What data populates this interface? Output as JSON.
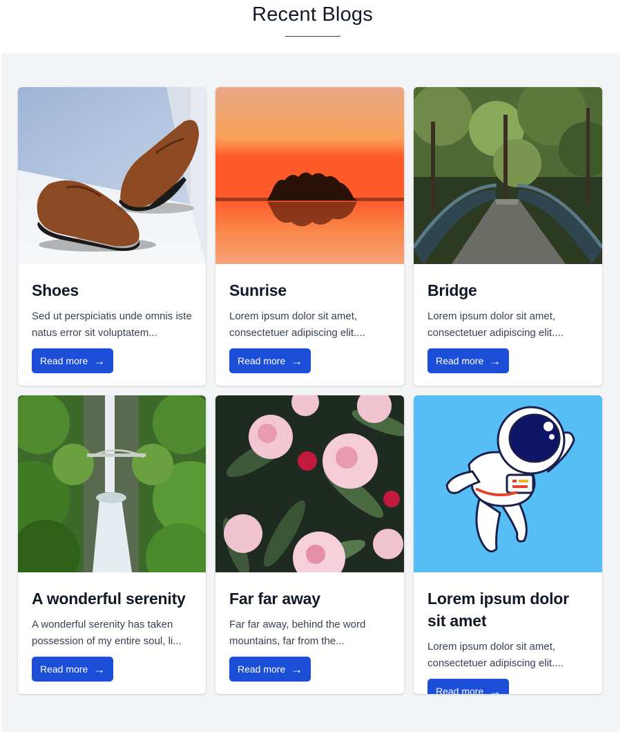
{
  "header": {
    "title": "Recent Blogs"
  },
  "colors": {
    "background": "#f3f4f6",
    "button": "#1d4ed8",
    "card": "#ffffff"
  },
  "posts": [
    {
      "title": "Shoes",
      "excerpt": "Sed ut perspiciatis unde omnis iste natus error sit voluptatem...",
      "button": "Read more",
      "image_icon": "shoes-image"
    },
    {
      "title": "Sunrise",
      "excerpt": "Lorem ipsum dolor sit amet, consectetuer adipiscing elit....",
      "button": "Read more",
      "image_icon": "sunrise-image"
    },
    {
      "title": "Bridge",
      "excerpt": "Lorem ipsum dolor sit amet, consectetuer adipiscing elit....",
      "button": "Read more",
      "image_icon": "bridge-image"
    },
    {
      "title": "A wonderful serenity",
      "excerpt": "A wonderful serenity has taken possession of my entire soul, li...",
      "button": "Read more",
      "image_icon": "waterfall-image"
    },
    {
      "title": "Far far away",
      "excerpt": "Far far away, behind the word mountains, far from the...",
      "button": "Read more",
      "image_icon": "flowers-image"
    },
    {
      "title": "Lorem ipsum dolor sit amet",
      "excerpt": "Lorem ipsum dolor sit amet, consectetuer adipiscing elit....",
      "button": "Read more",
      "image_icon": "astronaut-image"
    }
  ]
}
